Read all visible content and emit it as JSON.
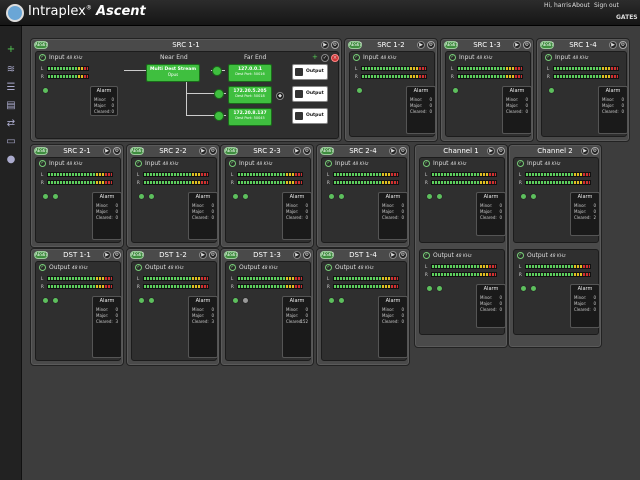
{
  "app": {
    "brand_pre": "Intraplex",
    "brand_sup": "®",
    "brand_name": "Ascent"
  },
  "toplinks": {
    "user": "Hi, harris",
    "about": "About",
    "signout": "Sign out",
    "vendor": "GATES"
  },
  "aes_badge": "AES67",
  "src11": {
    "title": "SRC 1-1",
    "input_label": "Input",
    "rate": "48 KHz",
    "near_end": "Near End",
    "far_end": "Far End",
    "stream": {
      "name": "Multi Dest Stream",
      "sub": "Opus"
    },
    "destinations": [
      {
        "ip": "127.0.0.1",
        "port": "Dest Port: 50016"
      },
      {
        "ip": "172.20.5.205",
        "port": "Dest Port: 50018"
      },
      {
        "ip": "172.20.8.137",
        "port": "Dest Port: 50045"
      }
    ],
    "output_label": "Output",
    "alarm": {
      "title": "Alarm",
      "minor": "Minor:",
      "minor_v": "0",
      "major": "Major:",
      "major_v": "0",
      "cleared": "Cleared:",
      "cleared_v": "0"
    }
  },
  "panels": [
    {
      "id": "src12",
      "title": "SRC 1-2",
      "sub": "Input",
      "rate": "48 KHz",
      "leds": 1,
      "minor": "0",
      "major": "0",
      "cleared": "0"
    },
    {
      "id": "src13",
      "title": "SRC 1-3",
      "sub": "Input",
      "rate": "48 KHz",
      "leds": 1,
      "minor": "0",
      "major": "0",
      "cleared": "0"
    },
    {
      "id": "src14",
      "title": "SRC 1-4",
      "sub": "Input",
      "rate": "48 KHz",
      "leds": 1,
      "minor": "0",
      "major": "0",
      "cleared": "0"
    },
    {
      "id": "src21",
      "title": "SRC 2-1",
      "sub": "Input",
      "rate": "48 KHz",
      "leds": 2,
      "minor": "0",
      "major": "0",
      "cleared": "0"
    },
    {
      "id": "src22",
      "title": "SRC 2-2",
      "sub": "Input",
      "rate": "48 KHz",
      "leds": 2,
      "minor": "0",
      "major": "0",
      "cleared": "0"
    },
    {
      "id": "src23",
      "title": "SRC 2-3",
      "sub": "Input",
      "rate": "48 KHz",
      "leds": 2,
      "minor": "0",
      "major": "0",
      "cleared": "0"
    },
    {
      "id": "src24",
      "title": "SRC 2-4",
      "sub": "Input",
      "rate": "48 KHz",
      "leds": 2,
      "minor": "0",
      "major": "0",
      "cleared": "0"
    },
    {
      "id": "dst11",
      "title": "DST 1-1",
      "sub": "Output",
      "rate": "48 KHz",
      "leds": 2,
      "minor": "0",
      "major": "0",
      "cleared": "3"
    },
    {
      "id": "dst12",
      "title": "DST 1-2",
      "sub": "Output",
      "rate": "48 KHz",
      "leds": 2,
      "minor": "0",
      "major": "0",
      "cleared": "3"
    },
    {
      "id": "dst13",
      "title": "DST 1-3",
      "sub": "Output",
      "rate": "48 KHz",
      "leds": 2,
      "minor": "0",
      "major": "0",
      "cleared": "152",
      "gray": true
    },
    {
      "id": "dst14",
      "title": "DST 1-4",
      "sub": "Output",
      "rate": "48 KHz",
      "leds": 2,
      "minor": "0",
      "major": "0",
      "cleared": "0"
    }
  ],
  "channels": [
    {
      "id": "ch1",
      "title": "Channel 1",
      "input": {
        "sub": "Input",
        "rate": "48 KHz",
        "minor": "0",
        "major": "0",
        "cleared": "0"
      },
      "output": {
        "sub": "Output",
        "rate": "48 KHz",
        "minor": "0",
        "major": "0",
        "cleared": "0"
      }
    },
    {
      "id": "ch2",
      "title": "Channel 2",
      "input": {
        "sub": "Input",
        "rate": "48 KHz",
        "minor": "0",
        "major": "0",
        "cleared": "2"
      },
      "output": {
        "sub": "Output",
        "rate": "48 KHz",
        "minor": "0",
        "major": "0",
        "cleared": "0"
      }
    }
  ],
  "alarm_labels": {
    "title": "Alarm",
    "minor": "Minor:",
    "major": "Major:",
    "cleared": "Cleared:"
  },
  "meter_labels": {
    "left": "L",
    "right": "R"
  },
  "colors": {
    "accent_green": "#3fbf3f",
    "meter_green": "#5dd05d",
    "meter_yellow": "#e0c020",
    "meter_red": "#d03030"
  }
}
